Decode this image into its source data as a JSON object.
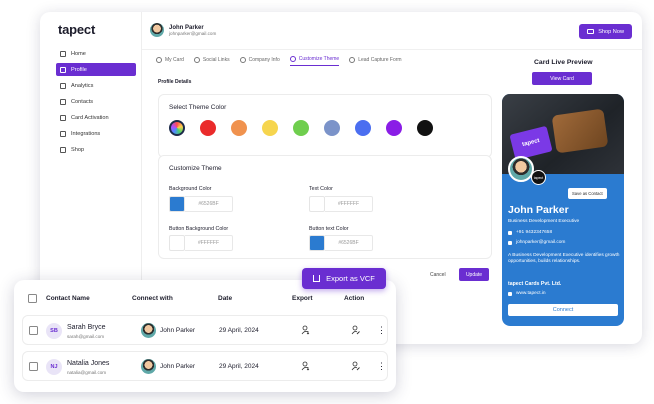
{
  "app": {
    "logo_text": "tapect",
    "user_name": "John Parker",
    "user_email": "johnparker@gmail.com",
    "shop_button": "Shop Now"
  },
  "sidebar": {
    "items": [
      {
        "label": "Home",
        "icon": "home-icon",
        "active": false
      },
      {
        "label": "Profile",
        "icon": "profile-icon",
        "active": true
      },
      {
        "label": "Analytics",
        "icon": "analytics-icon",
        "active": false
      },
      {
        "label": "Contacts",
        "icon": "contacts-icon",
        "active": false
      },
      {
        "label": "Card Activation",
        "icon": "card-icon",
        "active": false
      },
      {
        "label": "Integrations",
        "icon": "integrations-icon",
        "active": false
      },
      {
        "label": "Shop",
        "icon": "shop-icon",
        "active": false
      }
    ]
  },
  "tabs": [
    {
      "label": "My Card",
      "active": false
    },
    {
      "label": "Social Links",
      "active": false
    },
    {
      "label": "Company Info",
      "active": false
    },
    {
      "label": "Customize Theme",
      "active": true
    },
    {
      "label": "Lead Capture Form",
      "active": false
    }
  ],
  "profile_details_label": "Profile Details",
  "theme": {
    "title": "Select Theme Color",
    "colors": [
      "#ea2b2b",
      "#f0924e",
      "#f6d54e",
      "#6fce4e",
      "#7b93c9",
      "#4b6ef0",
      "#8a1de6",
      "#111111"
    ]
  },
  "customize": {
    "title": "Customize Theme",
    "background_color_label": "Background Color",
    "background_color_value": "#6526BF",
    "background_swatch": "#2b7bd0",
    "text_color_label": "Text Color",
    "text_color_value": "#FFFFFF",
    "button_bg_label": "Button Background Color",
    "button_bg_value": "#FFFFFF",
    "button_text_label": "Button text Color",
    "button_text_value": "#6526BF",
    "button_text_swatch": "#2b7bd0"
  },
  "actions": {
    "cancel": "Cancel",
    "update": "Update"
  },
  "preview": {
    "title": "Card Live Preview",
    "view_card": "View Card",
    "card_logo": "tapect",
    "card_badge": "tapect",
    "save_contact": "Save as Contact",
    "name": "John Parker",
    "role": "Business Development Executive",
    "phone": "+91 9432347658",
    "email": "johnparker@gmail.com",
    "description": "A Business Development Executive identifies growth opportunities, builds relationships.",
    "company": "tapect Cards Pvt. Ltd.",
    "website": "www.tapect.in",
    "connect": "Connect",
    "card_color": "#2b7bd0"
  },
  "contacts": {
    "export_button": "Export as VCF",
    "headers": {
      "name": "Contact Name",
      "connect": "Connect with",
      "date": "Date",
      "export": "Export",
      "action": "Action"
    },
    "rows": [
      {
        "initials": "SB",
        "name": "Sarah Bryce",
        "email": "sarah@gmail.com",
        "connect_with": "John Parker",
        "date": "29 April, 2024"
      },
      {
        "initials": "NJ",
        "name": "Natalia Jones",
        "email": "natalia@gmail.com",
        "connect_with": "John Parker",
        "date": "29 April, 2024"
      }
    ]
  }
}
